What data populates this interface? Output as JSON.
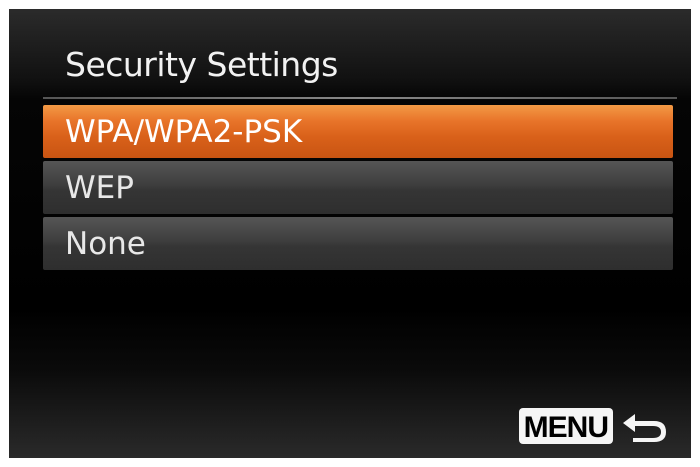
{
  "screen": {
    "title": "Security Settings"
  },
  "menu": {
    "items": [
      {
        "label": "WPA/WPA2-PSK",
        "selected": true
      },
      {
        "label": "WEP",
        "selected": false
      },
      {
        "label": "None",
        "selected": false
      }
    ]
  },
  "footer": {
    "menu_button_label": "MENU",
    "return_icon": "return-arrow-icon"
  },
  "colors": {
    "selected_accent": "#e8742a",
    "item_background": "#3e3e3e",
    "screen_background": "#000000"
  }
}
